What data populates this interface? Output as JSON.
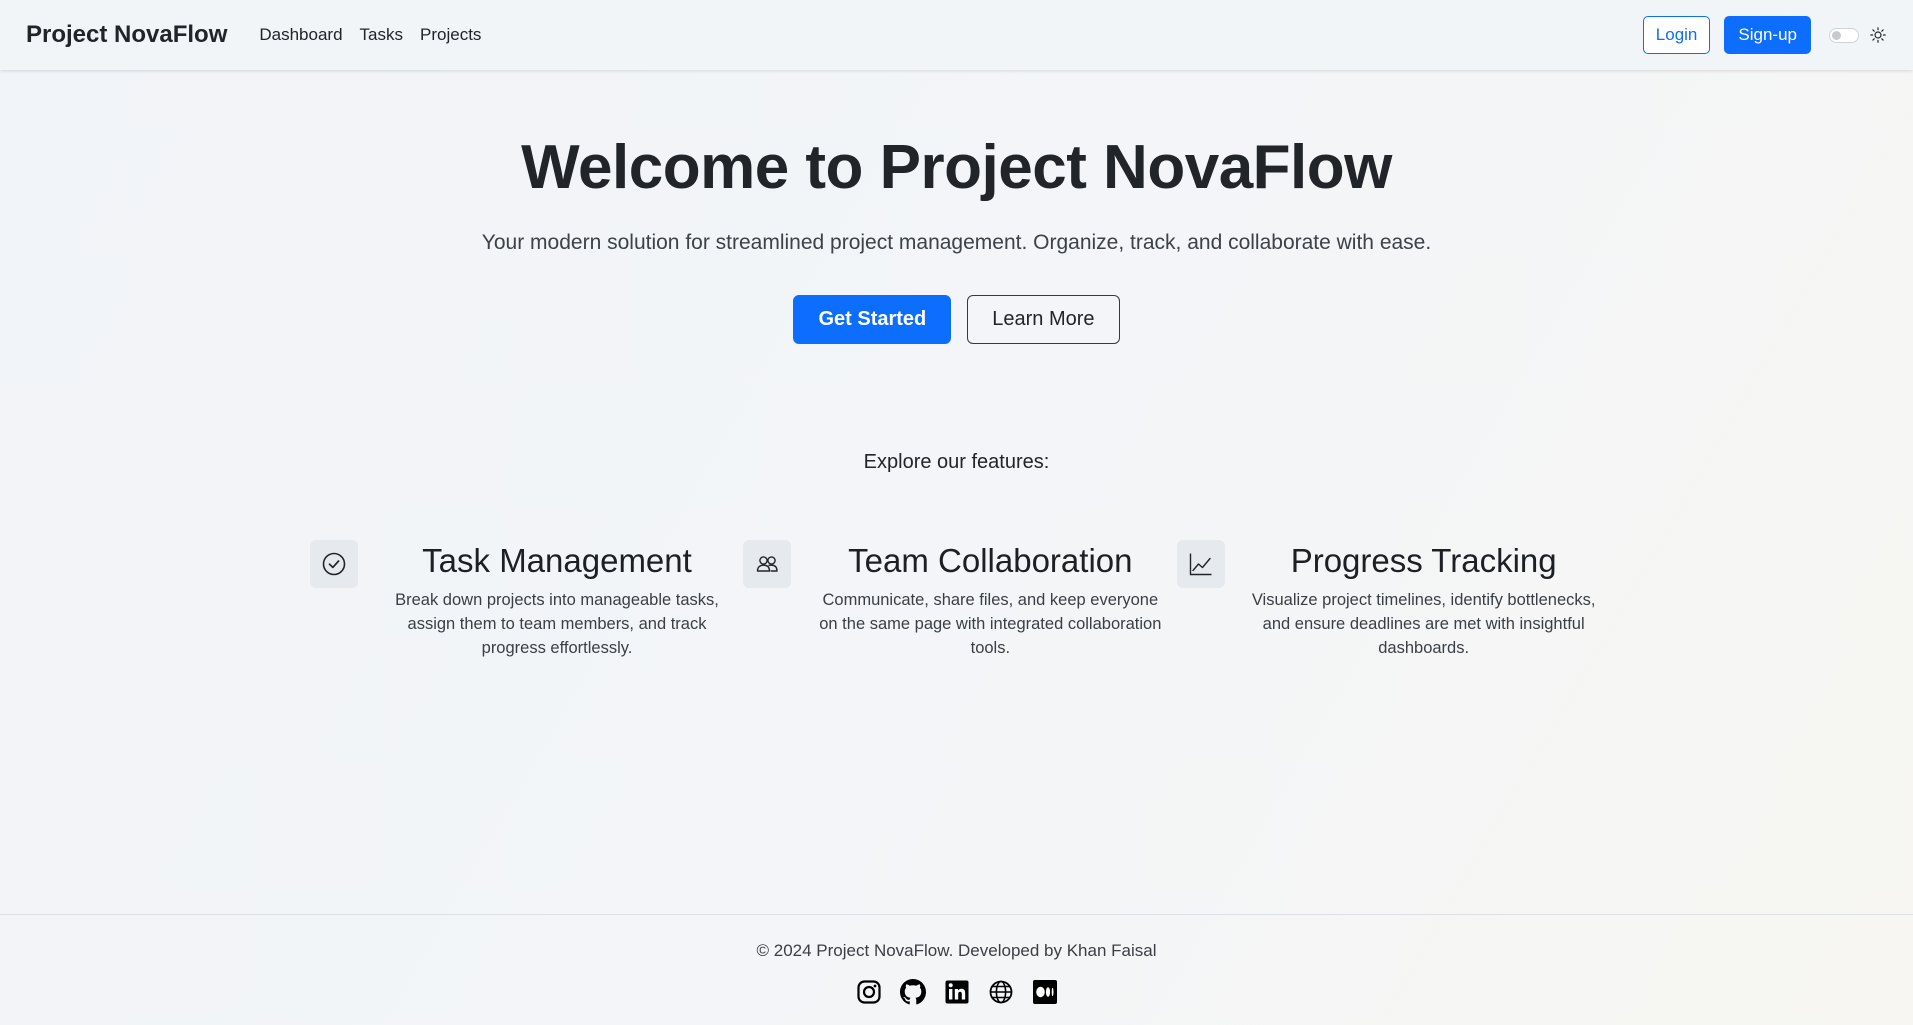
{
  "navbar": {
    "brand": "Project NovaFlow",
    "links": [
      "Dashboard",
      "Tasks",
      "Projects"
    ],
    "login_label": "Login",
    "signup_label": "Sign-up",
    "theme_toggle_icon": "sun-icon"
  },
  "hero": {
    "title": "Welcome to Project NovaFlow",
    "lead": "Your modern solution for streamlined project management. Organize, track, and collaborate with ease.",
    "primary_button": "Get Started",
    "secondary_button": "Learn More"
  },
  "explore_heading": "Explore our features:",
  "features": [
    {
      "icon": "check-circle-icon",
      "title": "Task Management",
      "text": "Break down projects into manageable tasks, assign them to team members, and track progress effortlessly."
    },
    {
      "icon": "people-icon",
      "title": "Team Collaboration",
      "text": "Communicate, share files, and keep everyone on the same page with integrated collaboration tools."
    },
    {
      "icon": "graph-up-icon",
      "title": "Progress Tracking",
      "text": "Visualize project timelines, identify bottlenecks, and ensure deadlines are met with insightful dashboards."
    }
  ],
  "footer": {
    "text": "© 2024 Project NovaFlow. Developed by Khan Faisal",
    "social_icons": [
      "instagram-icon",
      "github-icon",
      "linkedin-icon",
      "globe-icon",
      "medium-icon"
    ]
  },
  "colors": {
    "primary": "#0d6efd",
    "text": "#212529"
  }
}
